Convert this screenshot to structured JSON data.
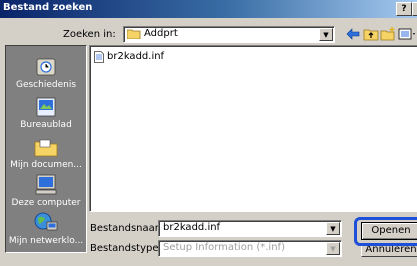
{
  "dialog": {
    "title": "Bestand zoeken",
    "help_button": "?",
    "close_button": "×"
  },
  "look_in": {
    "label": "Zoeken in:",
    "value": "Addprt"
  },
  "toolbar": {
    "icons": [
      "back-arrow-icon",
      "up-folder-icon",
      "new-folder-icon",
      "view-menu-icon"
    ]
  },
  "places": [
    {
      "label": "Geschiedenis",
      "icon": "history-icon"
    },
    {
      "label": "Bureaublad",
      "icon": "desktop-icon"
    },
    {
      "label": "Mijn documen...",
      "icon": "my-documents-icon"
    },
    {
      "label": "Deze computer",
      "icon": "my-computer-icon"
    },
    {
      "label": "Mijn netwerklo...",
      "icon": "network-places-icon"
    }
  ],
  "files": [
    {
      "name": "br2kadd.inf",
      "icon": "inf-file-icon"
    }
  ],
  "filename": {
    "label": "Bestandsnaam:",
    "value": "br2kadd.inf"
  },
  "filetype": {
    "label": "Bestandstypen:",
    "value": "Setup Information (*.inf)"
  },
  "buttons": {
    "open": "Openen",
    "cancel": "Annuleren"
  },
  "colors": {
    "title_bar": "#0a246a",
    "highlight": "#1e4fd8",
    "places_bar": "#808080"
  }
}
